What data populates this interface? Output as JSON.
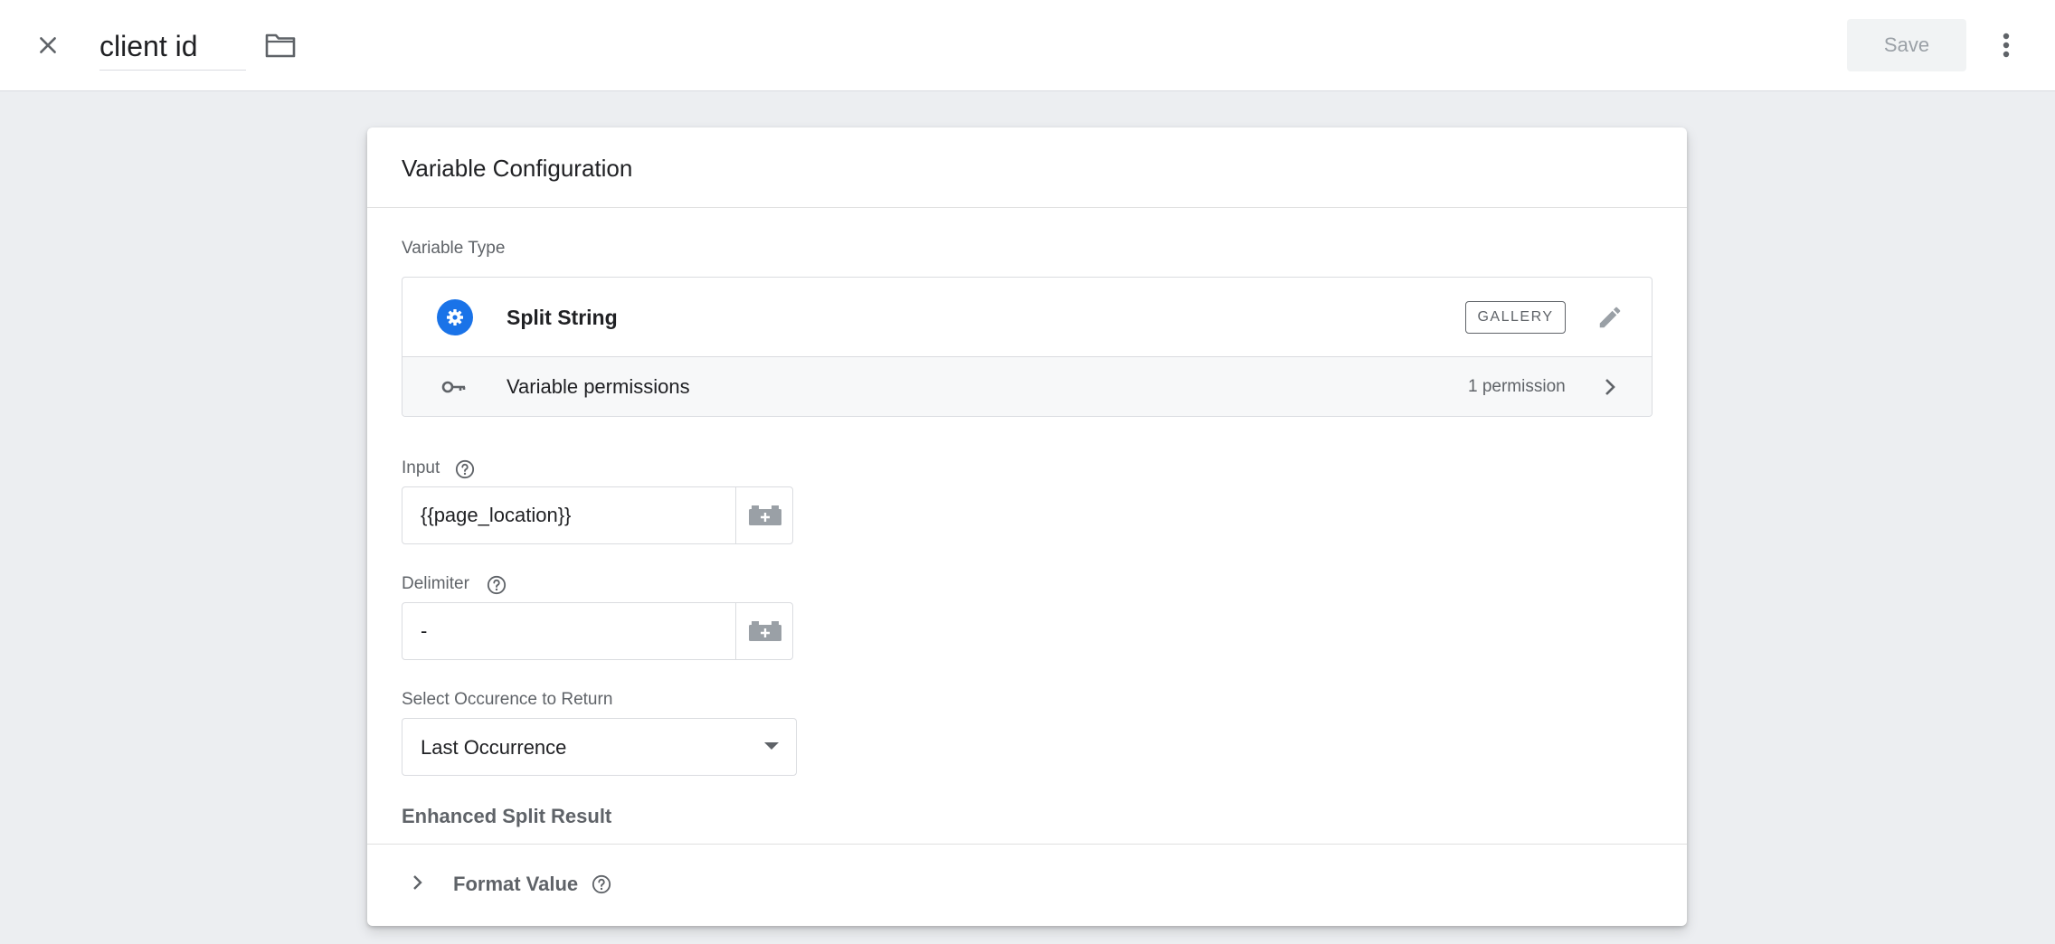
{
  "header": {
    "title": "client id",
    "save_label": "Save",
    "icons": {
      "close": "close-icon",
      "folder": "folder-icon",
      "more": "more-vert-icon"
    }
  },
  "card": {
    "title": "Variable Configuration",
    "variable_type": {
      "label": "Variable Type",
      "name": "Split String",
      "badge": "GALLERY",
      "icon": "gear-icon",
      "accent_color": "#1a73e8"
    },
    "permissions": {
      "label": "Variable permissions",
      "count": "1 permission",
      "icon": "key-icon"
    },
    "fields": {
      "input": {
        "label": "Input",
        "value": "{{page_location}}"
      },
      "delimiter": {
        "label": "Delimiter",
        "value": "-"
      }
    },
    "occurrence": {
      "label": "Select Occurence to Return",
      "selected": "Last Occurrence"
    },
    "enhanced_title": "Enhanced Split Result",
    "format_value": "Format Value"
  }
}
